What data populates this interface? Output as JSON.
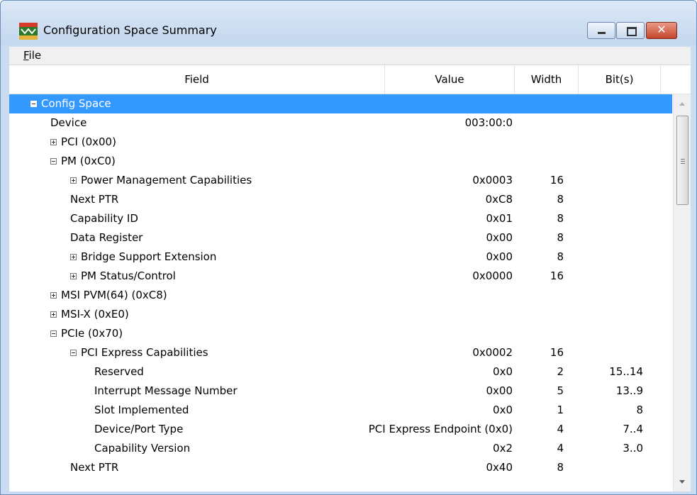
{
  "window": {
    "title": "Configuration Space Summary"
  },
  "menu": {
    "file_pre": "",
    "file_underlined": "F",
    "file_post": "ile"
  },
  "columns": {
    "field": "Field",
    "value": "Value",
    "width": "Width",
    "bits": "Bit(s)"
  },
  "rows": [
    {
      "label": "Config Space",
      "depth": 0,
      "toggle": "minus",
      "value": "",
      "width": "",
      "bits": "",
      "selected": true
    },
    {
      "label": "Device",
      "depth": 1,
      "toggle": "none",
      "value": "003:00:0",
      "width": "",
      "bits": ""
    },
    {
      "label": "PCI (0x00)",
      "depth": 1,
      "toggle": "plus",
      "value": "",
      "width": "",
      "bits": ""
    },
    {
      "label": "PM (0xC0)",
      "depth": 1,
      "toggle": "minus",
      "value": "",
      "width": "",
      "bits": ""
    },
    {
      "label": "Power Management Capabilities",
      "depth": 2,
      "toggle": "plus",
      "value": "0x0003",
      "width": "16",
      "bits": ""
    },
    {
      "label": "Next PTR",
      "depth": 2,
      "toggle": "none",
      "value": "0xC8",
      "width": "8",
      "bits": ""
    },
    {
      "label": "Capability ID",
      "depth": 2,
      "toggle": "none",
      "value": "0x01",
      "width": "8",
      "bits": ""
    },
    {
      "label": "Data Register",
      "depth": 2,
      "toggle": "none",
      "value": "0x00",
      "width": "8",
      "bits": ""
    },
    {
      "label": "Bridge Support Extension",
      "depth": 2,
      "toggle": "plus",
      "value": "0x00",
      "width": "8",
      "bits": ""
    },
    {
      "label": "PM Status/Control",
      "depth": 2,
      "toggle": "plus",
      "value": "0x0000",
      "width": "16",
      "bits": ""
    },
    {
      "label": "MSI PVM(64) (0xC8)",
      "depth": 1,
      "toggle": "plus",
      "value": "",
      "width": "",
      "bits": ""
    },
    {
      "label": "MSI-X (0xE0)",
      "depth": 1,
      "toggle": "plus",
      "value": "",
      "width": "",
      "bits": ""
    },
    {
      "label": "PCIe (0x70)",
      "depth": 1,
      "toggle": "minus",
      "value": "",
      "width": "",
      "bits": ""
    },
    {
      "label": "PCI Express Capabilities",
      "depth": 2,
      "toggle": "minus",
      "value": "0x0002",
      "width": "16",
      "bits": ""
    },
    {
      "label": "Reserved",
      "depth": 3,
      "toggle": "none",
      "value": "0x0",
      "width": "2",
      "bits": "15..14"
    },
    {
      "label": "Interrupt Message Number",
      "depth": 3,
      "toggle": "none",
      "value": "0x00",
      "width": "5",
      "bits": "13..9"
    },
    {
      "label": "Slot Implemented",
      "depth": 3,
      "toggle": "none",
      "value": "0x0",
      "width": "1",
      "bits": "8"
    },
    {
      "label": "Device/Port Type",
      "depth": 3,
      "toggle": "none",
      "value": "PCI Express Endpoint (0x0)",
      "width": "4",
      "bits": "7..4"
    },
    {
      "label": "Capability Version",
      "depth": 3,
      "toggle": "none",
      "value": "0x2",
      "width": "4",
      "bits": "3..0"
    },
    {
      "label": "Next PTR",
      "depth": 2,
      "toggle": "none",
      "value": "0x40",
      "width": "8",
      "bits": ""
    }
  ]
}
